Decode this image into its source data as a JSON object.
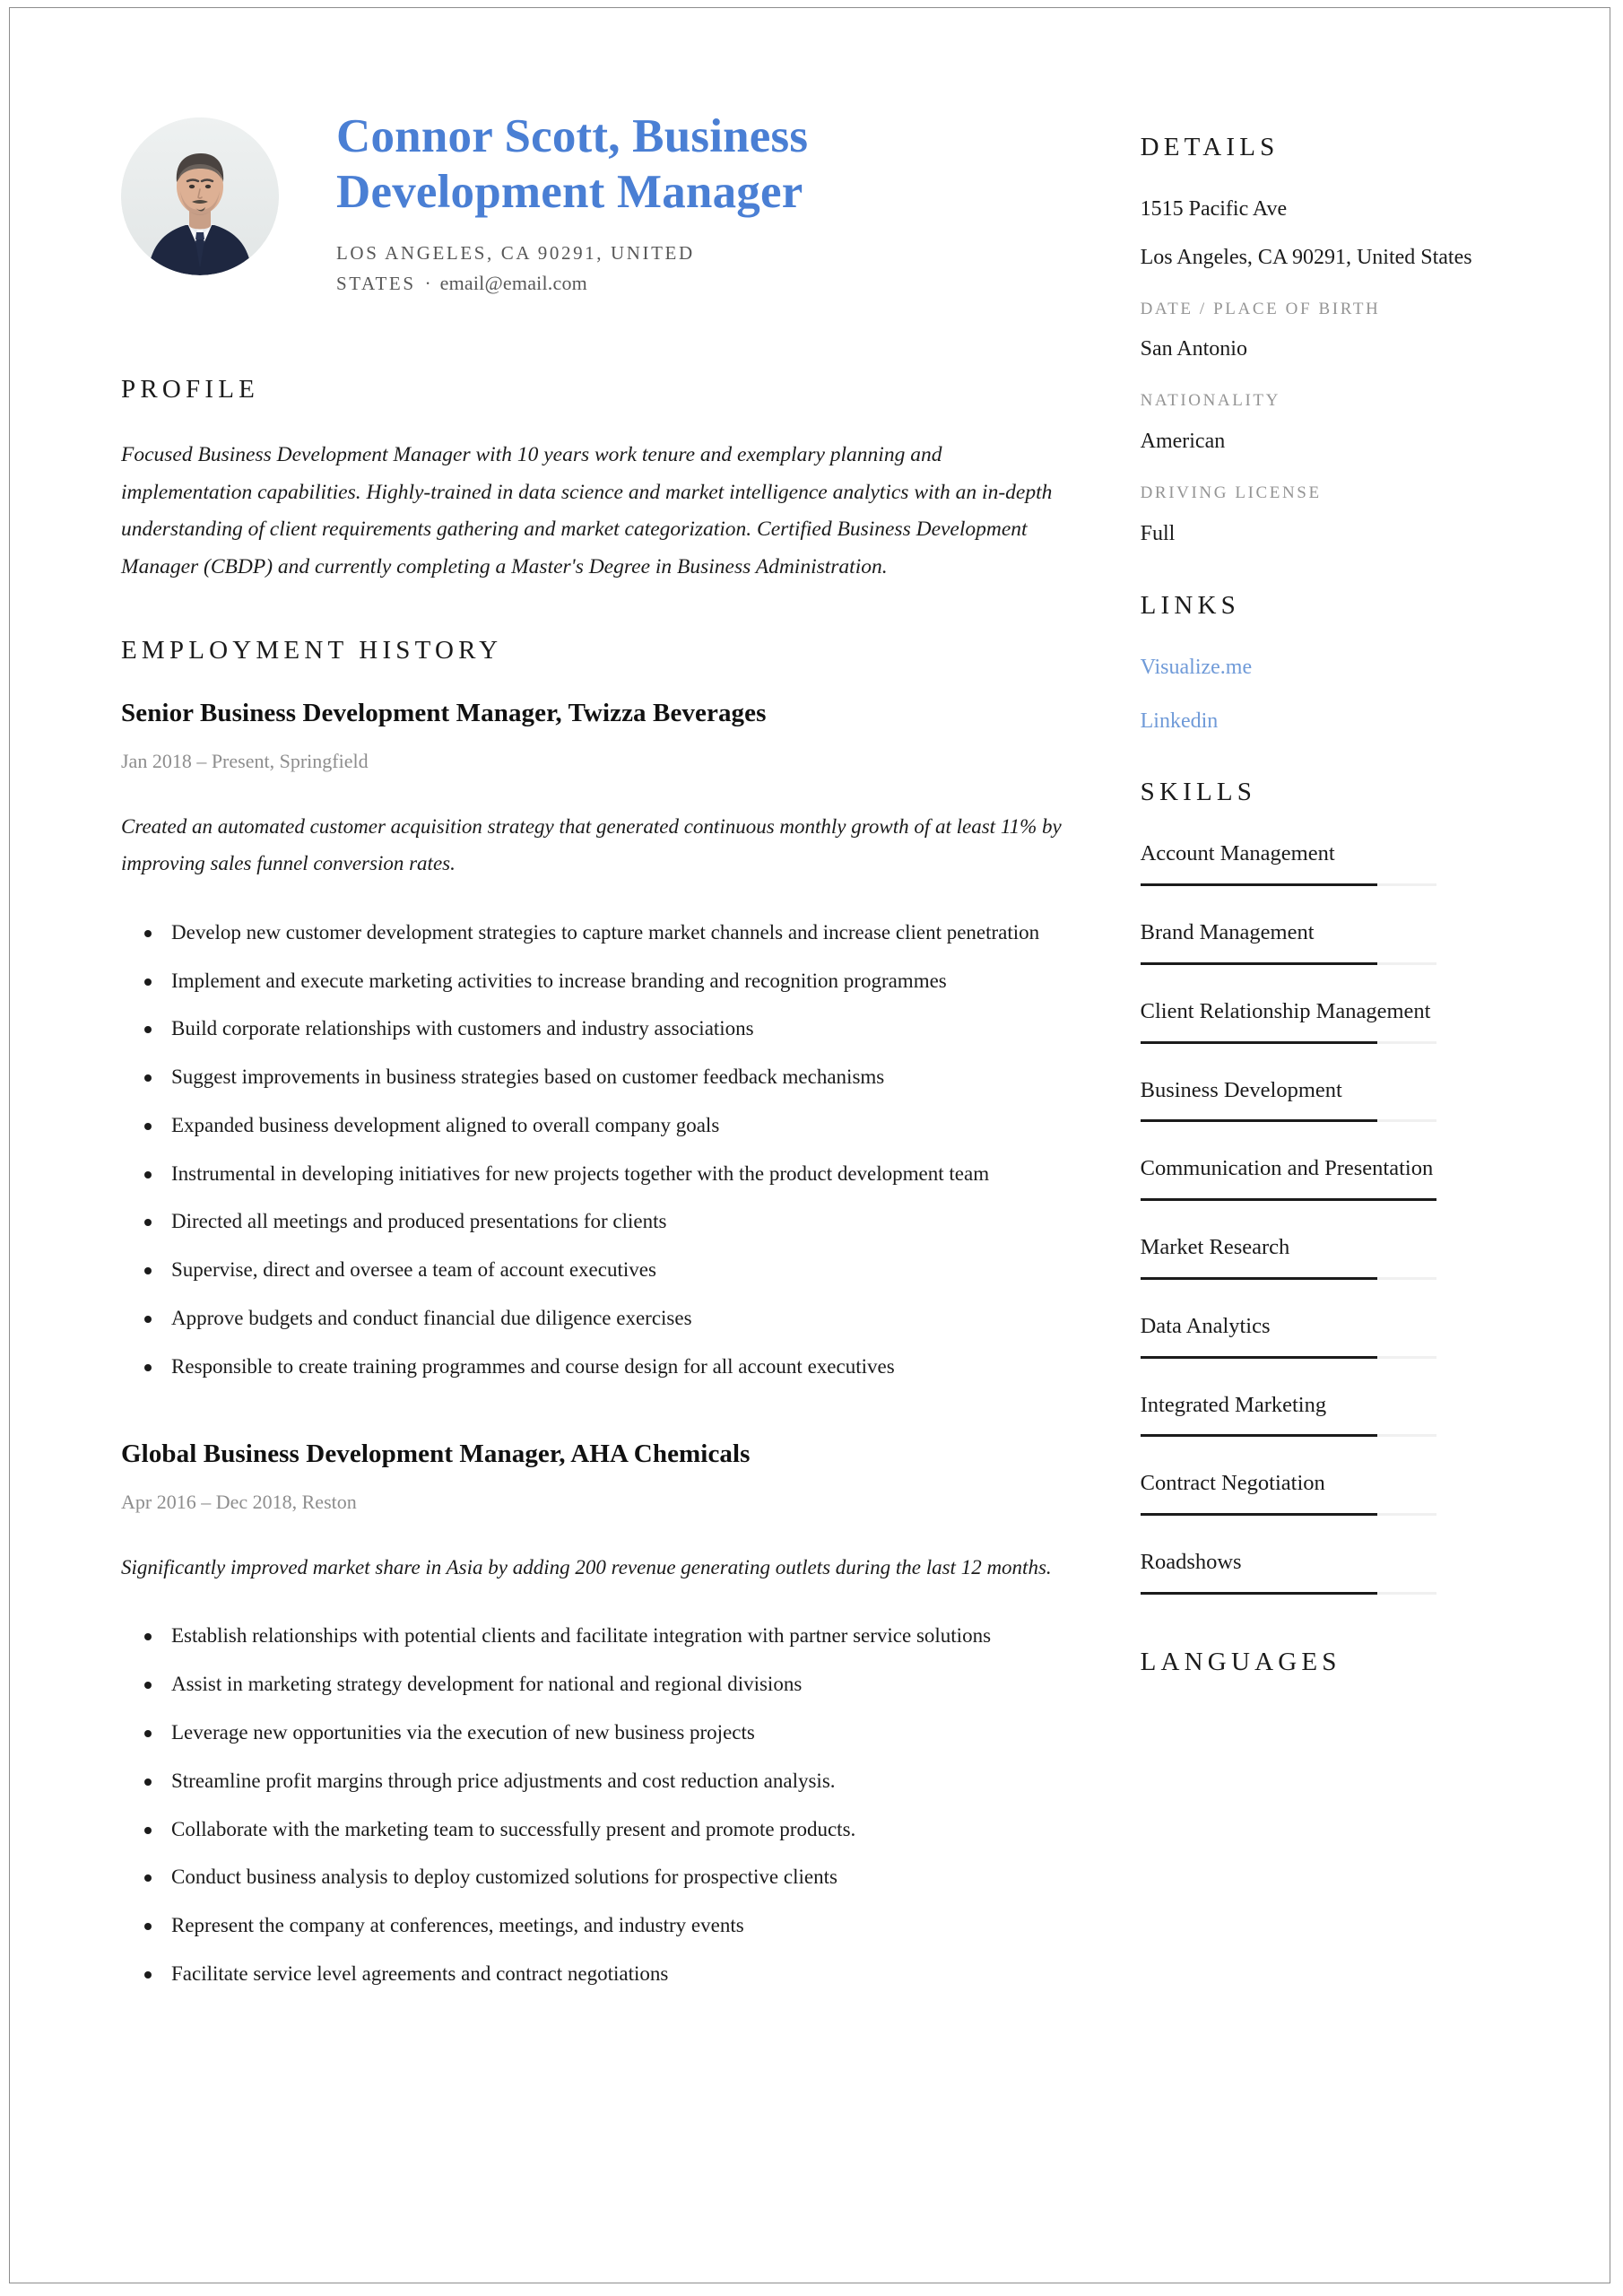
{
  "header": {
    "name_title": "Connor Scott, Business Development Manager",
    "location": "LOS ANGELES, CA 90291, UNITED STATES",
    "separator": "·",
    "email": "email@email.com"
  },
  "main": {
    "profile": {
      "heading": "PROFILE",
      "text": "Focused Business Development Manager with 10 years work tenure and exemplary planning and implementation capabilities. Highly-trained in data science and market intelligence analytics with an in-depth understanding of client requirements gathering and market categorization. Certified Business Development Manager (CBDP) and currently completing a Master's Degree in Business Administration."
    },
    "employment": {
      "heading": "EMPLOYMENT HISTORY",
      "jobs": [
        {
          "title": "Senior Business Development Manager, Twizza Beverages",
          "meta": "Jan 2018 – Present, Springfield",
          "summary": "Created an automated customer acquisition strategy that generated continuous monthly growth of at least 11% by improving sales funnel conversion rates.",
          "bullets": [
            "Develop new customer development strategies to capture market channels and increase client penetration",
            "Implement and execute marketing activities to increase branding and recognition programmes",
            "Build corporate relationships with customers and industry associations",
            "Suggest improvements in business strategies based on customer feedback mechanisms",
            "Expanded business development aligned to overall company goals",
            "Instrumental in developing initiatives for new projects together with the product development team",
            "Directed all meetings and produced presentations for clients",
            "Supervise, direct and oversee a team of account executives",
            "Approve budgets and conduct financial due diligence exercises",
            "Responsible to create training programmes and course design for all account executives"
          ]
        },
        {
          "title": "Global Business Development Manager, AHA Chemicals",
          "meta": "Apr 2016 – Dec 2018, Reston",
          "summary": "Significantly improved market share in Asia by adding 200 revenue generating outlets during the last 12 months.",
          "bullets": [
            "Establish relationships with potential clients and facilitate integration with partner service solutions",
            "Assist in marketing strategy development for national and regional divisions",
            "Leverage new opportunities via the execution of new business projects",
            "Streamline profit margins through price adjustments and cost reduction analysis.",
            "Collaborate with the marketing team to successfully present and promote products.",
            "Conduct business analysis to deploy customized solutions for prospective clients",
            "Represent the company at conferences, meetings, and industry events",
            "Facilitate service level agreements and contract negotiations"
          ]
        }
      ]
    }
  },
  "sidebar": {
    "details": {
      "heading": "DETAILS",
      "address_line1": "1515 Pacific Ave",
      "address_line2": "Los Angeles, CA 90291, United States",
      "birth_label": "DATE / PLACE OF BIRTH",
      "birth_value": "San Antonio",
      "nationality_label": "NATIONALITY",
      "nationality_value": "American",
      "license_label": "DRIVING LICENSE",
      "license_value": "Full"
    },
    "links": {
      "heading": "LINKS",
      "items": [
        {
          "label": "Visualize.me"
        },
        {
          "label": "Linkedin"
        }
      ]
    },
    "skills": {
      "heading": "SKILLS",
      "items": [
        {
          "name": "Account Management",
          "level": 80
        },
        {
          "name": "Brand Management",
          "level": 80
        },
        {
          "name": "Client Relationship Management",
          "level": 80
        },
        {
          "name": "Business Development",
          "level": 80
        },
        {
          "name": "Communication and Presentation",
          "level": 100
        },
        {
          "name": "Market Research",
          "level": 80
        },
        {
          "name": "Data Analytics",
          "level": 80
        },
        {
          "name": "Integrated Marketing",
          "level": 80
        },
        {
          "name": "Contract Negotiation",
          "level": 80
        },
        {
          "name": "Roadshows",
          "level": 80
        }
      ]
    },
    "languages": {
      "heading": "LANGUAGES"
    }
  },
  "colors": {
    "accent_name": "#4a7fd4",
    "link": "#6f9ad8",
    "muted_label": "#949494",
    "text": "#1b1b1b",
    "bar_filled": "#1b1b1b",
    "bar_track": "#f0f0f0"
  }
}
